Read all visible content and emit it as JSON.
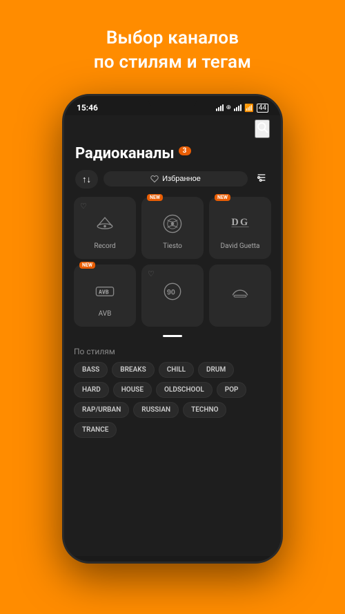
{
  "header": {
    "line1": "Выбор каналов",
    "line2": "по стилям и тегам"
  },
  "statusBar": {
    "time": "15:46",
    "badge_icon": "✓"
  },
  "screen": {
    "title": "Радиоканалы",
    "badge_count": "3",
    "sort_label": "↑↓",
    "favorites_label": "Избранное",
    "search_icon": "🔍",
    "heart_icon": "♡",
    "filter_icon": "⊟"
  },
  "cards": [
    {
      "name": "Record",
      "has_heart": true,
      "is_new": false,
      "logo_type": "record"
    },
    {
      "name": "Tiesto",
      "has_heart": false,
      "is_new": true,
      "logo_type": "tiesto"
    },
    {
      "name": "David Guetta",
      "has_heart": false,
      "is_new": true,
      "logo_type": "dg"
    },
    {
      "name": "AVB",
      "has_heart": false,
      "is_new": true,
      "logo_type": "avb"
    },
    {
      "name": "",
      "has_heart": true,
      "is_new": false,
      "logo_type": "radio90"
    },
    {
      "name": "",
      "has_heart": false,
      "is_new": false,
      "logo_type": "lounge"
    }
  ],
  "styles_section": {
    "title": "По стилям",
    "tags": [
      "BASS",
      "BREAKS",
      "CHILL",
      "DRUM",
      "HARD",
      "HOUSE",
      "OLDSCHOOL",
      "POP",
      "RAP/URBAN",
      "RUSSIAN",
      "TECHNO",
      "TRANCE"
    ]
  }
}
